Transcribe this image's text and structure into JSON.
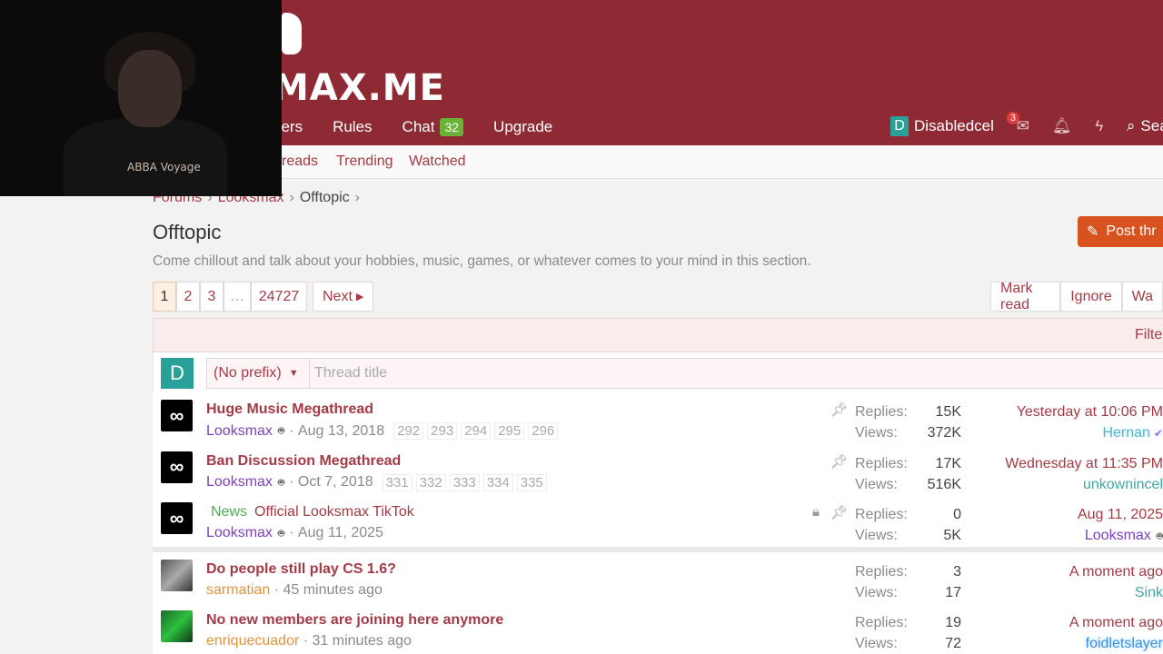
{
  "site": {
    "logo_text": "MAX.ME"
  },
  "nav": {
    "items": [
      "Members",
      "Rules",
      "Chat",
      "Upgrade"
    ],
    "members_label": "bers",
    "chat_count": "32",
    "user_initial": "D",
    "username": "Disabledcel",
    "inbox_count": "3",
    "search_label": "Sea"
  },
  "subnav": {
    "items": [
      "reads",
      "Trending",
      "Watched"
    ]
  },
  "webcam": {
    "shirt_text": "ABBA Voyage"
  },
  "breadcrumb": {
    "items": [
      "Forums",
      "Looksmax",
      "Offtopic"
    ]
  },
  "page": {
    "title": "Offtopic",
    "description": "Come chillout and talk about your hobbies, music, games, or whatever comes to your mind in this section.",
    "post_button": "Post thr"
  },
  "pagination": {
    "pages": [
      "1",
      "2",
      "3",
      "…",
      "24727"
    ],
    "next": "Next"
  },
  "actions": {
    "mark_read": "Mark read",
    "ignore": "Ignore",
    "watch": "Wa"
  },
  "filters": {
    "label": "Filte"
  },
  "quick_thread": {
    "avatar": "D",
    "prefix": "(No prefix)",
    "placeholder": "Thread title"
  },
  "threads": [
    {
      "title": "Huge Music Megathread",
      "author": "Looksmax",
      "date": "Aug 13, 2018",
      "pages": [
        "292",
        "293",
        "294",
        "295",
        "296"
      ],
      "replies": "15K",
      "views": "372K",
      "last_date": "Yesterday at 10:06 PM",
      "last_user": "Hernan"
    },
    {
      "title": "Ban Discussion Megathread",
      "author": "Looksmax",
      "date": "Oct 7, 2018",
      "pages": [
        "331",
        "332",
        "333",
        "334",
        "335"
      ],
      "replies": "17K",
      "views": "516K",
      "last_date": "Wednesday at 11:35 PM",
      "last_user": "unkownincel"
    },
    {
      "prefix": "News",
      "title": "Official Looksmax TikTok",
      "author": "Looksmax",
      "date": "Aug 11, 2025",
      "replies": "0",
      "views": "5K",
      "last_date": "Aug 11, 2025",
      "last_user": "Looksmax"
    },
    {
      "title": "Do people still play CS 1.6?",
      "author": "sarmatian",
      "date": "45 minutes ago",
      "replies": "3",
      "views": "17",
      "last_date": "A moment ago",
      "last_user": "Sink"
    },
    {
      "title": "No new members are joining here anymore",
      "author": "enriquecuador",
      "date": "31 minutes ago",
      "replies": "19",
      "views": "72",
      "last_date": "A moment ago",
      "last_user": "foidletslayer"
    }
  ],
  "labels": {
    "replies": "Replies:",
    "views": "Views:"
  }
}
